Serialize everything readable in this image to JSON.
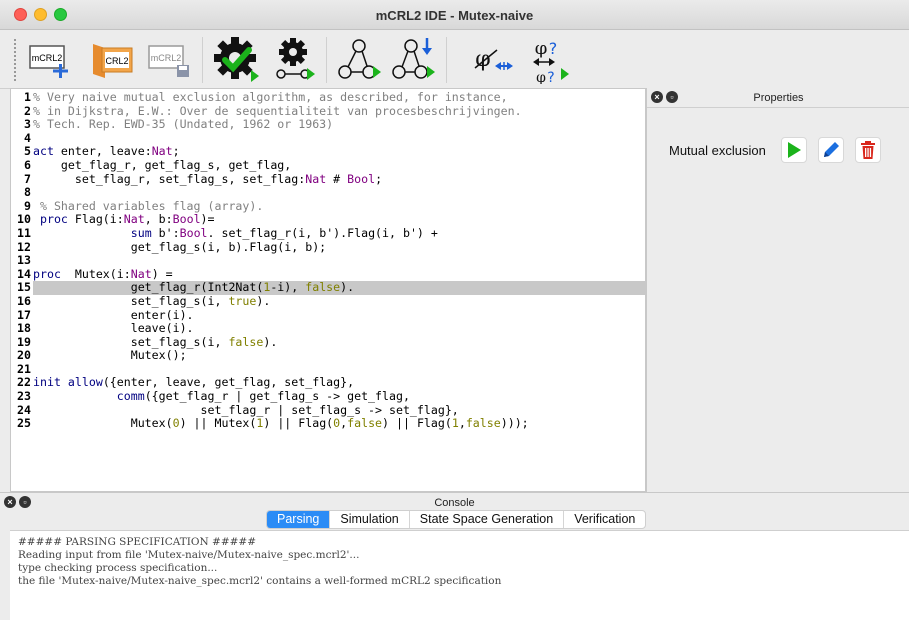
{
  "window": {
    "title": "mCRL2 IDE - Mutex-naive"
  },
  "toolbar": {
    "new_icon_text": "mCRL2",
    "open_icon_text": "CRL2",
    "save_icon_text": "mCRL2"
  },
  "editor": {
    "lines": [
      {
        "n": "1",
        "t": "% Very naive mutual exclusion algorithm, as described, for instance,"
      },
      {
        "n": "2",
        "t": "% in Dijkstra, E.W.: Over de sequentialiteit van procesbeschrijvingen."
      },
      {
        "n": "3",
        "t": "% Tech. Rep. EWD-35 (Undated, 1962 or 1963)"
      },
      {
        "n": "4",
        "t": ""
      },
      {
        "n": "5",
        "t": "act enter, leave:Nat;"
      },
      {
        "n": "6",
        "t": "    get_flag_r, get_flag_s, get_flag,"
      },
      {
        "n": "7",
        "t": "      set_flag_r, set_flag_s, set_flag:Nat # Bool;"
      },
      {
        "n": "8",
        "t": ""
      },
      {
        "n": "9",
        "t": " % Shared variables flag (array)."
      },
      {
        "n": "10",
        "t": " proc Flag(i:Nat, b:Bool)="
      },
      {
        "n": "11",
        "t": "              sum b':Bool. set_flag_r(i, b').Flag(i, b') +"
      },
      {
        "n": "12",
        "t": "              get_flag_s(i, b).Flag(i, b);"
      },
      {
        "n": "13",
        "t": ""
      },
      {
        "n": "14",
        "t": "proc  Mutex(i:Nat) ="
      },
      {
        "n": "15",
        "t": "              get_flag_r(Int2Nat(1-i), false)."
      },
      {
        "n": "16",
        "t": "              set_flag_s(i, true)."
      },
      {
        "n": "17",
        "t": "              enter(i)."
      },
      {
        "n": "18",
        "t": "              leave(i)."
      },
      {
        "n": "19",
        "t": "              set_flag_s(i, false)."
      },
      {
        "n": "20",
        "t": "              Mutex();"
      },
      {
        "n": "21",
        "t": ""
      },
      {
        "n": "22",
        "t": "init allow({enter, leave, get_flag, set_flag},"
      },
      {
        "n": "23",
        "t": "            comm({get_flag_r | get_flag_s -> get_flag,"
      },
      {
        "n": "24",
        "t": "                        set_flag_r | set_flag_s -> set_flag},"
      },
      {
        "n": "25",
        "t": "              Mutex(0) || Mutex(1) || Flag(0,false) || Flag(1,false)));"
      }
    ],
    "highlighted_line": "15"
  },
  "properties": {
    "title": "Properties",
    "items": [
      {
        "label": "Mutual exclusion"
      }
    ]
  },
  "console": {
    "title": "Console",
    "tabs": [
      "Parsing",
      "Simulation",
      "State Space Generation",
      "Verification"
    ],
    "active_tab": "Parsing",
    "log": [
      "##### PARSING SPECIFICATION #####",
      "Reading input from file 'Mutex-naive/Mutex-naive_spec.mcrl2'...",
      "type checking process specification...",
      "the file 'Mutex-naive/Mutex-naive_spec.mcrl2' contains a well-formed mCRL2 specification"
    ]
  },
  "colors": {
    "accent": "#2b8cf6",
    "run_green": "#1bb31b",
    "edit_blue": "#1b6fe0",
    "delete_red": "#d9261c"
  }
}
